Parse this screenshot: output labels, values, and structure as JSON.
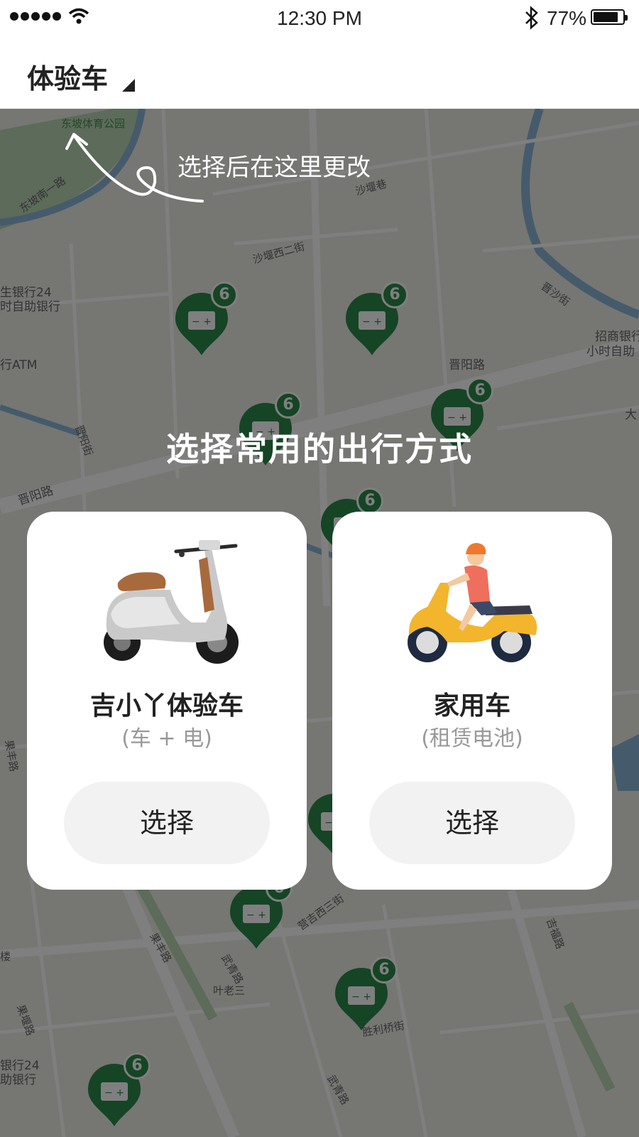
{
  "status_bar": {
    "time": "12:30 PM",
    "battery_percent": "77%",
    "signal_icon": "signal-dots-icon",
    "wifi_icon": "wifi-icon",
    "bluetooth_icon": "bluetooth-icon",
    "battery_icon": "battery-icon",
    "battery_level": 0.77
  },
  "header": {
    "mode_label": "体验车",
    "dropdown_icon": "triangle-down-icon"
  },
  "map": {
    "labels": [
      "东坡体育公园",
      "东坡南一路",
      "沙堰巷",
      "沙堰西二街",
      "生银行24",
      "时自助银行",
      "行ATM",
      "晋沙街",
      "招商银行",
      "小时自助",
      "晋阳路",
      "晋阳路",
      "晋阳街",
      "大",
      "果丰路",
      "营吉西三街",
      "果丰路",
      "武青路",
      "叶老三",
      "吉福路",
      "楼",
      "银行24",
      "助银行",
      "果堰路",
      "胜利桥街",
      "武青路"
    ],
    "pin_badge_count": "6",
    "pin_icon": "battery-station-icon",
    "accent_color": "#2a8a4a"
  },
  "overlay": {
    "hint": "选择后在这里更改",
    "title": "选择常用的出行方式"
  },
  "cards": [
    {
      "title": "吉小丫体验车",
      "subtitle": "(车 + 电)",
      "button": "选择",
      "image": "electric-scooter-image"
    },
    {
      "title": "家用车",
      "subtitle": "(租赁电池)",
      "button": "选择",
      "image": "scooter-rider-image"
    }
  ]
}
